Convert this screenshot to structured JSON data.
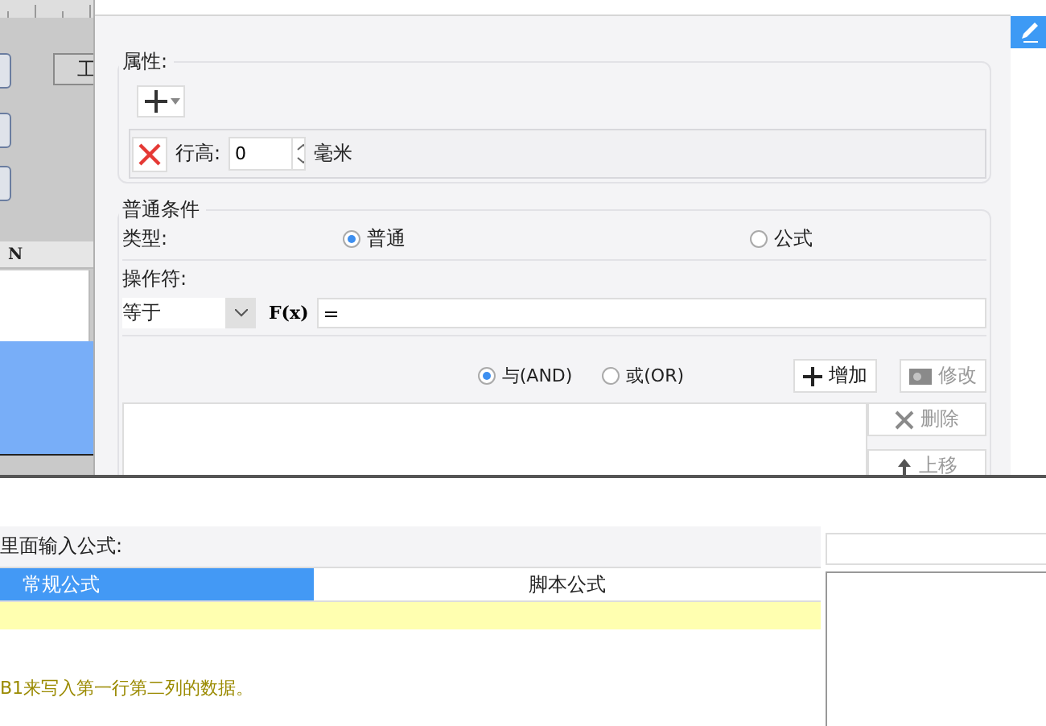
{
  "background_app": {
    "partial_button": "工",
    "column_header": "N"
  },
  "dialog": {
    "properties": {
      "title": "属性:",
      "row_height_label": "行高:",
      "row_height_value": "0",
      "unit": "毫米"
    },
    "condition": {
      "title": "普通条件",
      "type_label": "类型:",
      "type_options": [
        {
          "label": "普通",
          "selected": true
        },
        {
          "label": "公式",
          "selected": false
        }
      ],
      "operator_label": "操作符:",
      "operator": "等于",
      "formula_button": "F(x)",
      "value": "=",
      "logic_options": [
        {
          "label": "与(AND)",
          "selected": true
        },
        {
          "label": "或(OR)",
          "selected": false
        }
      ],
      "buttons": [
        {
          "kind": "add",
          "label": "增加",
          "disabled": false
        },
        {
          "kind": "edit",
          "label": "修改",
          "disabled": true
        }
      ],
      "side_buttons": [
        {
          "kind": "delete",
          "label": "删除",
          "disabled": true
        },
        {
          "kind": "up",
          "label": "上移",
          "disabled": true
        }
      ]
    }
  },
  "formula_window": {
    "prompt": "里面输入公式:",
    "tabs": [
      {
        "label": "常规公式",
        "selected": true
      },
      {
        "label": "脚本公式",
        "selected": false
      }
    ],
    "hint": "B1来写入第一行第二列的数据。"
  }
}
